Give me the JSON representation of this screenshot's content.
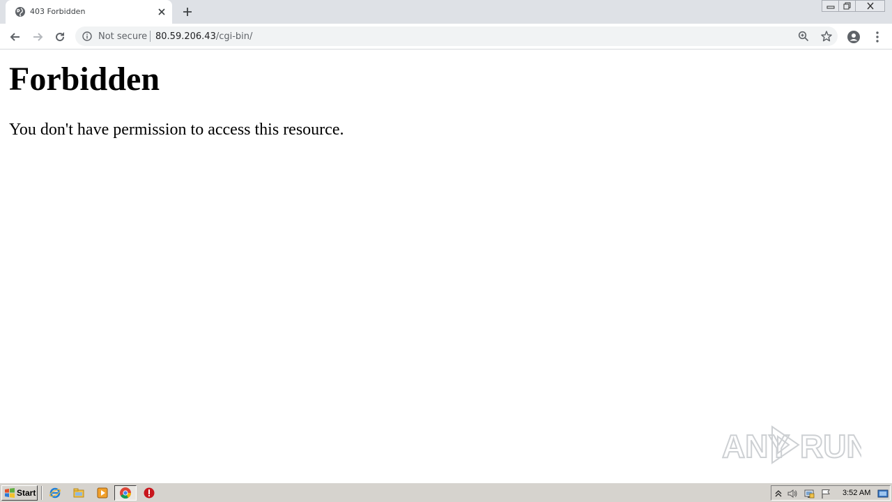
{
  "browser": {
    "tab": {
      "title": "403 Forbidden"
    },
    "omnibox": {
      "security_label": "Not secure",
      "url_host": "80.59.206.43",
      "url_path": "/cgi-bin/"
    }
  },
  "page": {
    "heading": "Forbidden",
    "message": "You don't have permission to access this resource."
  },
  "watermark": {
    "text_left": "ANY",
    "text_right": "RUN"
  },
  "taskbar": {
    "start_label": "Start",
    "clock": "3:52 AM"
  },
  "colors": {
    "tabstrip_bg": "#dee1e6",
    "omnibox_bg": "#f1f3f4",
    "taskbar_bg": "#d6d3ce"
  }
}
